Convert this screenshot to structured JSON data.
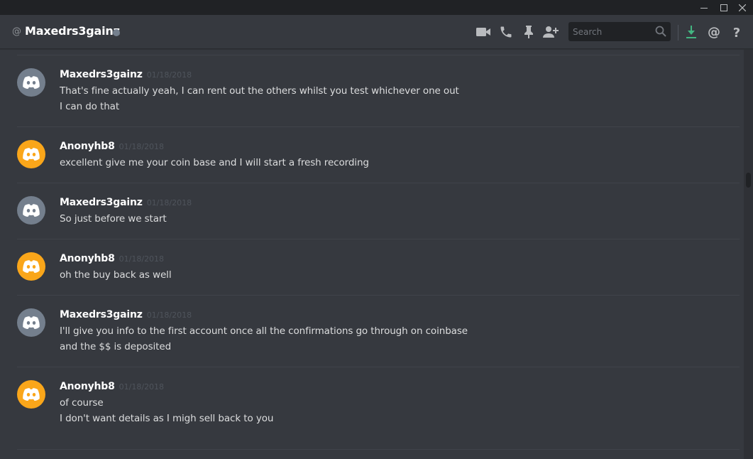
{
  "window": {
    "controls": [
      "minimize",
      "maximize",
      "close"
    ]
  },
  "header": {
    "at_symbol": "@",
    "channel_name": "Maxedrs3gainz",
    "status_color": "#747f8d",
    "icons": [
      "video-call-icon",
      "phone-call-icon",
      "pin-icon",
      "add-friend-icon",
      "download-icon",
      "mention-icon",
      "help-icon"
    ],
    "search_placeholder": "Search"
  },
  "colors": {
    "grey_avatar": "#747f8d",
    "orange_avatar": "#faa61a",
    "download_accent": "#43b581"
  },
  "messages": [
    {
      "author": "Maxedrs3gainz",
      "timestamp": "01/18/2018",
      "avatar": "grey",
      "lines": [
        "That's fine actually yeah, I can rent out the others whilst you test whichever one out",
        "I can do that"
      ]
    },
    {
      "author": "Anonyhb8",
      "timestamp": "01/18/2018",
      "avatar": "orange",
      "lines": [
        "excellent give me your coin base and I will start a fresh recording"
      ]
    },
    {
      "author": "Maxedrs3gainz",
      "timestamp": "01/18/2018",
      "avatar": "grey",
      "lines": [
        "So just before we start"
      ]
    },
    {
      "author": "Anonyhb8",
      "timestamp": "01/18/2018",
      "avatar": "orange",
      "lines": [
        "oh the buy back as well"
      ]
    },
    {
      "author": "Maxedrs3gainz",
      "timestamp": "01/18/2018",
      "avatar": "grey",
      "lines": [
        "I'll give you info to the first account once all the confirmations go through on coinbase",
        "and the $$ is deposited"
      ]
    },
    {
      "author": "Anonyhb8",
      "timestamp": "01/18/2018",
      "avatar": "orange",
      "lines": [
        "of course",
        "I don't want details as I migh sell back to you"
      ]
    }
  ]
}
